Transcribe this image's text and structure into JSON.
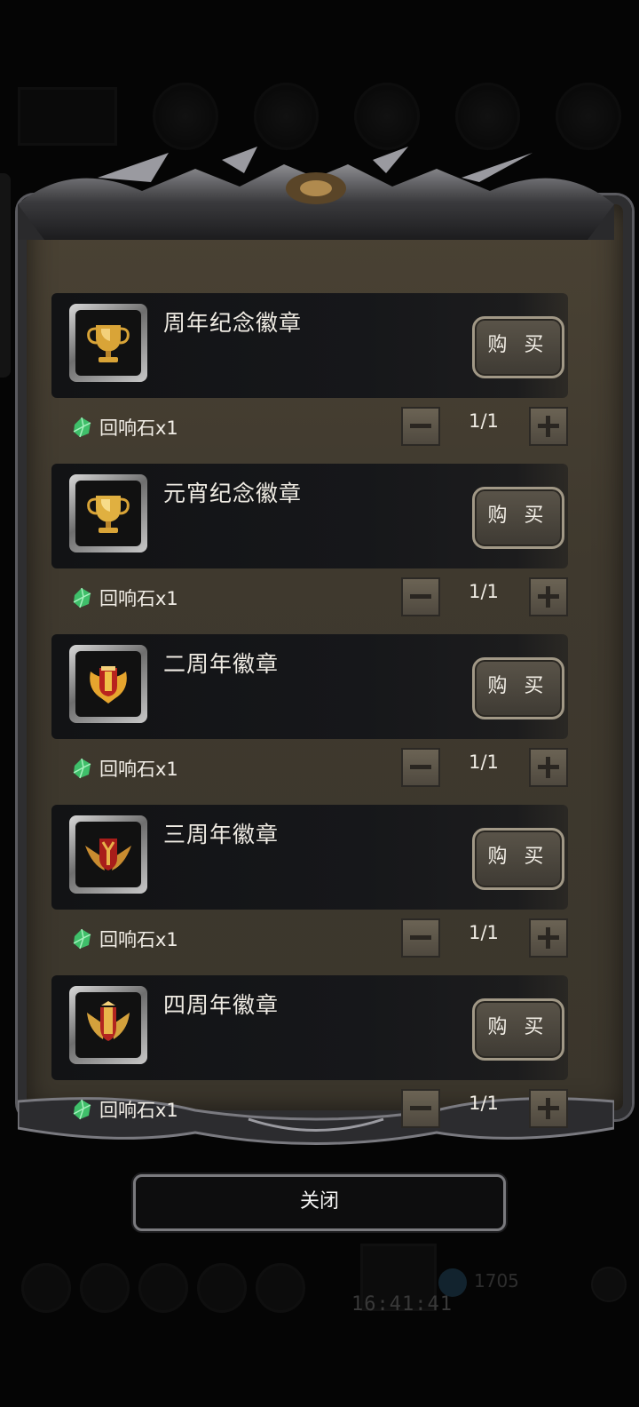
{
  "shop": {
    "items": [
      {
        "name": "周年纪念徽章",
        "buy_label": "购 买",
        "cost": "回响石x1",
        "qty": "1/1",
        "badge": "gold-trophy-icon"
      },
      {
        "name": "元宵纪念徽章",
        "buy_label": "购 买",
        "cost": "回响石x1",
        "qty": "1/1",
        "badge": "gold-trophy-icon"
      },
      {
        "name": "二周年徽章",
        "buy_label": "购 买",
        "cost": "回响石x1",
        "qty": "1/1",
        "badge": "red-crest-icon"
      },
      {
        "name": "三周年徽章",
        "buy_label": "购 买",
        "cost": "回响石x1",
        "qty": "1/1",
        "badge": "winged-crest-icon"
      },
      {
        "name": "四周年徽章",
        "buy_label": "购 买",
        "cost": "回响石x1",
        "qty": "1/1",
        "badge": "laurel-crest-icon"
      }
    ]
  },
  "close_label": "关闭",
  "background": {
    "time": "16:41:41",
    "currency": "1705"
  },
  "colors": {
    "panel": "#3f392e",
    "gold": "#d9a437",
    "gem": "#3fbf6a",
    "accent_red": "#b8231e"
  }
}
